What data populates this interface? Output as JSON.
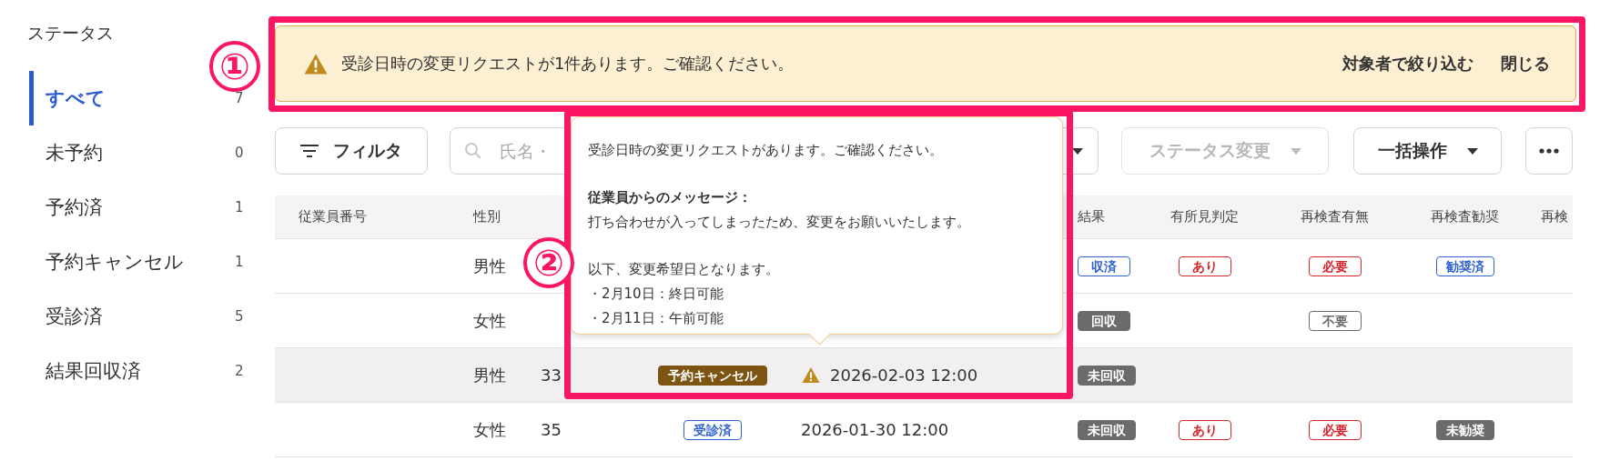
{
  "sidebar": {
    "title": "ステータス",
    "items": [
      {
        "label": "すべて",
        "count": "7",
        "selected": true
      },
      {
        "label": "未予約",
        "count": "0",
        "selected": false
      },
      {
        "label": "予約済",
        "count": "1",
        "selected": false
      },
      {
        "label": "予約キャンセル",
        "count": "1",
        "selected": false
      },
      {
        "label": "受診済",
        "count": "5",
        "selected": false
      },
      {
        "label": "結果回収済",
        "count": "2",
        "selected": false
      }
    ]
  },
  "alert": {
    "message": "受診日時の変更リクエストが1件あります。ご確認ください。",
    "actions": [
      "対象者で絞り込む",
      "閉じる"
    ]
  },
  "toolbar": {
    "filter_button": "フィルタ",
    "search": {
      "placeholder": "氏名・"
    },
    "buttons": [
      {
        "label": "ステータス変更",
        "disabled": true
      },
      {
        "label": "一括操作",
        "disabled": false
      }
    ]
  },
  "table": {
    "columns": [
      "従業員番号",
      "性別",
      "結果",
      "有所見判定",
      "再検査有無",
      "再検査勧奨",
      "再検"
    ],
    "rows": [
      {
        "highlighted": false,
        "gender": "男性",
        "result": {
          "text": "収済",
          "kind": "outline",
          "color": "#2f62d0"
        },
        "finding": {
          "text": "あり",
          "kind": "outline",
          "color": "#d9262e"
        },
        "recheck": {
          "text": "必要",
          "kind": "outline",
          "color": "#d9262e"
        },
        "recommend": {
          "text": "勧奨済",
          "kind": "outline",
          "color": "#2f62d0"
        }
      },
      {
        "highlighted": false,
        "gender": "女性",
        "result": {
          "text": "回収",
          "kind": "filled",
          "color": "#6b6b6b"
        },
        "recheck": {
          "text": "不要",
          "kind": "outline",
          "color": "#6b6b6b"
        }
      },
      {
        "highlighted": true,
        "gender": "男性",
        "age": "33",
        "status": {
          "text": "予約キャンセル",
          "kind": "filled",
          "color": "#7d5412"
        },
        "date": {
          "text": "2026-02-03 12:00",
          "warning": true
        },
        "result": {
          "text": "未回収",
          "kind": "filled",
          "color": "#6b6b6b"
        }
      },
      {
        "highlighted": false,
        "gender": "女性",
        "age": "35",
        "status": {
          "text": "受診済",
          "kind": "outline",
          "color": "#2f62d0"
        },
        "date": {
          "text": "2026-01-30 12:00",
          "warning": false
        },
        "result": {
          "text": "未回収",
          "kind": "filled",
          "color": "#6b6b6b"
        },
        "finding": {
          "text": "あり",
          "kind": "outline",
          "color": "#d9262e"
        },
        "recheck": {
          "text": "必要",
          "kind": "outline",
          "color": "#d9262e"
        },
        "recommend": {
          "text": "未勧奨",
          "kind": "filled",
          "color": "#6b6b6b"
        }
      }
    ]
  },
  "tooltip": {
    "intro": "受診日時の変更リクエストがあります。ご確認ください。",
    "message_title": "従業員からのメッセージ：",
    "message": "打ち合わせが入ってしまったため、変更をお願いいたします。",
    "dates_title": "以下、変更希望日となります。",
    "dates": [
      "・2月10日：終日可能",
      "・2月11日：午前可能"
    ]
  },
  "annotations": [
    {
      "number": "①"
    },
    {
      "number": "②"
    }
  ]
}
